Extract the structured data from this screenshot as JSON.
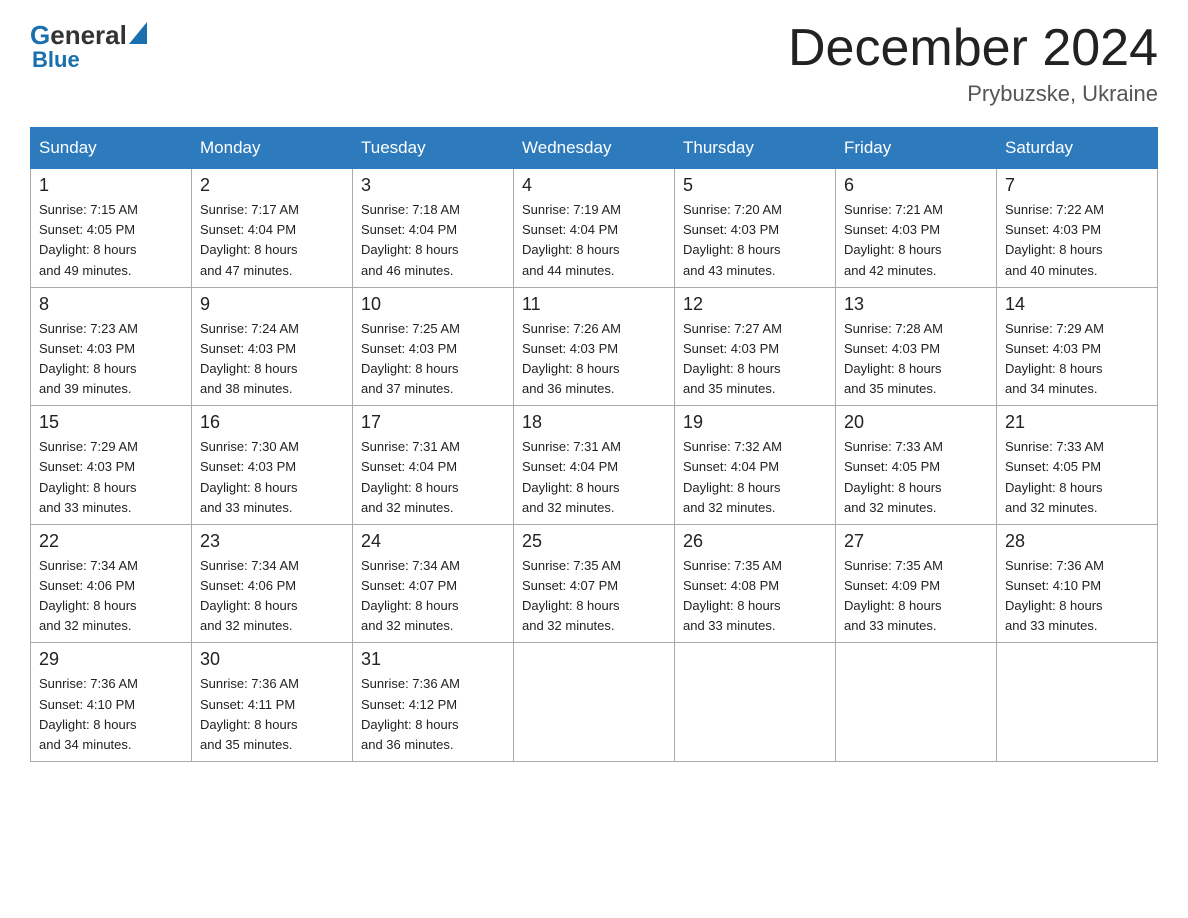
{
  "header": {
    "logo_general": "General",
    "logo_blue": "Blue",
    "month_year": "December 2024",
    "location": "Prybuzske, Ukraine"
  },
  "days_of_week": [
    "Sunday",
    "Monday",
    "Tuesday",
    "Wednesday",
    "Thursday",
    "Friday",
    "Saturday"
  ],
  "weeks": [
    [
      {
        "day": "1",
        "sunrise": "7:15 AM",
        "sunset": "4:05 PM",
        "daylight": "8 hours and 49 minutes."
      },
      {
        "day": "2",
        "sunrise": "7:17 AM",
        "sunset": "4:04 PM",
        "daylight": "8 hours and 47 minutes."
      },
      {
        "day": "3",
        "sunrise": "7:18 AM",
        "sunset": "4:04 PM",
        "daylight": "8 hours and 46 minutes."
      },
      {
        "day": "4",
        "sunrise": "7:19 AM",
        "sunset": "4:04 PM",
        "daylight": "8 hours and 44 minutes."
      },
      {
        "day": "5",
        "sunrise": "7:20 AM",
        "sunset": "4:03 PM",
        "daylight": "8 hours and 43 minutes."
      },
      {
        "day": "6",
        "sunrise": "7:21 AM",
        "sunset": "4:03 PM",
        "daylight": "8 hours and 42 minutes."
      },
      {
        "day": "7",
        "sunrise": "7:22 AM",
        "sunset": "4:03 PM",
        "daylight": "8 hours and 40 minutes."
      }
    ],
    [
      {
        "day": "8",
        "sunrise": "7:23 AM",
        "sunset": "4:03 PM",
        "daylight": "8 hours and 39 minutes."
      },
      {
        "day": "9",
        "sunrise": "7:24 AM",
        "sunset": "4:03 PM",
        "daylight": "8 hours and 38 minutes."
      },
      {
        "day": "10",
        "sunrise": "7:25 AM",
        "sunset": "4:03 PM",
        "daylight": "8 hours and 37 minutes."
      },
      {
        "day": "11",
        "sunrise": "7:26 AM",
        "sunset": "4:03 PM",
        "daylight": "8 hours and 36 minutes."
      },
      {
        "day": "12",
        "sunrise": "7:27 AM",
        "sunset": "4:03 PM",
        "daylight": "8 hours and 35 minutes."
      },
      {
        "day": "13",
        "sunrise": "7:28 AM",
        "sunset": "4:03 PM",
        "daylight": "8 hours and 35 minutes."
      },
      {
        "day": "14",
        "sunrise": "7:29 AM",
        "sunset": "4:03 PM",
        "daylight": "8 hours and 34 minutes."
      }
    ],
    [
      {
        "day": "15",
        "sunrise": "7:29 AM",
        "sunset": "4:03 PM",
        "daylight": "8 hours and 33 minutes."
      },
      {
        "day": "16",
        "sunrise": "7:30 AM",
        "sunset": "4:03 PM",
        "daylight": "8 hours and 33 minutes."
      },
      {
        "day": "17",
        "sunrise": "7:31 AM",
        "sunset": "4:04 PM",
        "daylight": "8 hours and 32 minutes."
      },
      {
        "day": "18",
        "sunrise": "7:31 AM",
        "sunset": "4:04 PM",
        "daylight": "8 hours and 32 minutes."
      },
      {
        "day": "19",
        "sunrise": "7:32 AM",
        "sunset": "4:04 PM",
        "daylight": "8 hours and 32 minutes."
      },
      {
        "day": "20",
        "sunrise": "7:33 AM",
        "sunset": "4:05 PM",
        "daylight": "8 hours and 32 minutes."
      },
      {
        "day": "21",
        "sunrise": "7:33 AM",
        "sunset": "4:05 PM",
        "daylight": "8 hours and 32 minutes."
      }
    ],
    [
      {
        "day": "22",
        "sunrise": "7:34 AM",
        "sunset": "4:06 PM",
        "daylight": "8 hours and 32 minutes."
      },
      {
        "day": "23",
        "sunrise": "7:34 AM",
        "sunset": "4:06 PM",
        "daylight": "8 hours and 32 minutes."
      },
      {
        "day": "24",
        "sunrise": "7:34 AM",
        "sunset": "4:07 PM",
        "daylight": "8 hours and 32 minutes."
      },
      {
        "day": "25",
        "sunrise": "7:35 AM",
        "sunset": "4:07 PM",
        "daylight": "8 hours and 32 minutes."
      },
      {
        "day": "26",
        "sunrise": "7:35 AM",
        "sunset": "4:08 PM",
        "daylight": "8 hours and 33 minutes."
      },
      {
        "day": "27",
        "sunrise": "7:35 AM",
        "sunset": "4:09 PM",
        "daylight": "8 hours and 33 minutes."
      },
      {
        "day": "28",
        "sunrise": "7:36 AM",
        "sunset": "4:10 PM",
        "daylight": "8 hours and 33 minutes."
      }
    ],
    [
      {
        "day": "29",
        "sunrise": "7:36 AM",
        "sunset": "4:10 PM",
        "daylight": "8 hours and 34 minutes."
      },
      {
        "day": "30",
        "sunrise": "7:36 AM",
        "sunset": "4:11 PM",
        "daylight": "8 hours and 35 minutes."
      },
      {
        "day": "31",
        "sunrise": "7:36 AM",
        "sunset": "4:12 PM",
        "daylight": "8 hours and 36 minutes."
      },
      null,
      null,
      null,
      null
    ]
  ],
  "labels": {
    "sunrise_prefix": "Sunrise: ",
    "sunset_prefix": "Sunset: ",
    "daylight_prefix": "Daylight: "
  }
}
